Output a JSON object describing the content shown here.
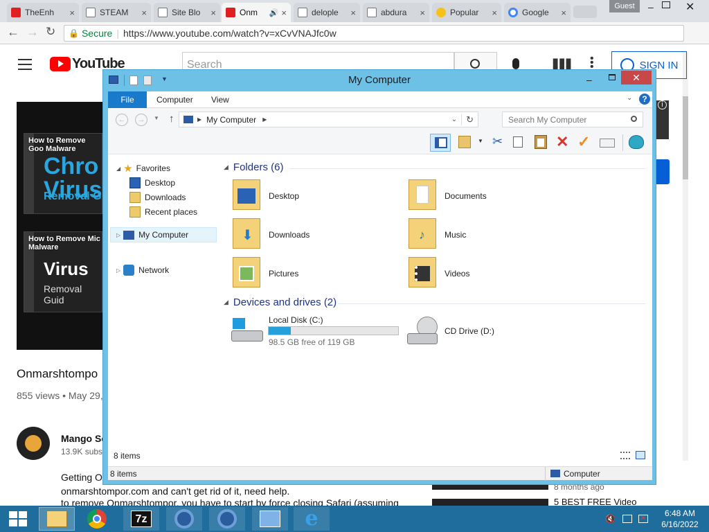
{
  "browser": {
    "tabs": [
      {
        "title": "TheEnh",
        "fav": "youtube-icon"
      },
      {
        "title": "STEAM",
        "fav": "page-icon"
      },
      {
        "title": "Site Blo",
        "fav": "page-icon"
      },
      {
        "title": "Onm",
        "fav": "youtube-icon",
        "active": true
      },
      {
        "title": "delople",
        "fav": "page-icon"
      },
      {
        "title": "abdura",
        "fav": "page-icon"
      },
      {
        "title": "Popular",
        "fav": "smile-icon"
      },
      {
        "title": "Google",
        "fav": "google-icon"
      }
    ],
    "profile": "Guest",
    "secure_label": "Secure",
    "url": "https://www.youtube.com/watch?v=xCvVNAJfc0w"
  },
  "youtube": {
    "logo_text": "YouTube",
    "search_placeholder": "Search",
    "signin_label": "SIGN IN",
    "thumb1_title": "How to Remove Goo Malware",
    "thumb1_big": "Chro Virus",
    "thumb1_sub": "Removal G",
    "thumb2_title": "How to Remove Mic Malware",
    "thumb2_big": "Virus",
    "thumb2_sub": "Removal Guid",
    "video_title": "Onmarshtompo",
    "views": "855 views • May 29,",
    "channel": "Mango Sc",
    "subs": "13.9K subs",
    "desc1": "Getting O",
    "desc2": "onmarshtompor.com and can't get rid of it, need help.",
    "desc3": "to remove Onmarshtompor, you have to start by force closing Safari (assuming",
    "side_meta": "8 months ago",
    "side_title": "5 BEST FREE Video"
  },
  "explorer": {
    "title": "My Computer",
    "ribbon_tabs": [
      "File",
      "Computer",
      "View"
    ],
    "crumb": "My Computer",
    "search_placeholder": "Search My Computer",
    "nav": {
      "favorites": "Favorites",
      "desktop": "Desktop",
      "downloads": "Downloads",
      "recent": "Recent places",
      "computer": "My Computer",
      "network": "Network"
    },
    "folders_header": "Folders (6)",
    "folders": [
      "Desktop",
      "Documents",
      "Downloads",
      "Music",
      "Pictures",
      "Videos"
    ],
    "devices_header": "Devices and drives (2)",
    "drive_c": {
      "name": "Local Disk (C:)",
      "free": "98.5 GB free of 119 GB",
      "used_fraction": 0.17
    },
    "drive_d": {
      "name": "CD Drive (D:)"
    },
    "item_count": "8 items",
    "status_items": "8 items",
    "status_location": "Computer"
  },
  "taskbar": {
    "time": "6:48 AM",
    "date": "6/16/2022"
  },
  "colors": {
    "window_frame": "#6ec1e6",
    "file_tab": "#1979ca",
    "taskbar": "#1e6d9c",
    "close_button": "#c74848",
    "drive_bar": "#26a0da"
  }
}
